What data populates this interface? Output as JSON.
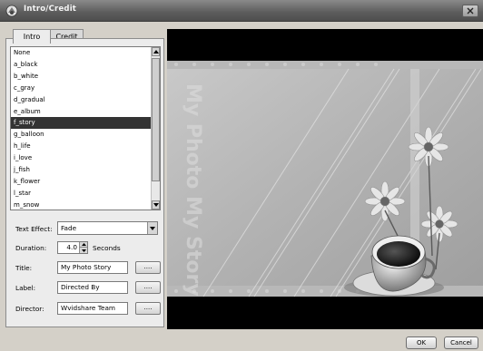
{
  "window": {
    "title": "Intro/Credit"
  },
  "tabs": [
    {
      "label": "Intro"
    },
    {
      "label": "Credit"
    }
  ],
  "templates": [
    "None",
    "a_black",
    "b_white",
    "c_gray",
    "d_gradual",
    "e_album",
    "f_story",
    "g_balloon",
    "h_life",
    "i_love",
    "j_fish",
    "k_flower",
    "l_star",
    "m_snow"
  ],
  "selected_template": "f_story",
  "fields": {
    "text_effect": {
      "label": "Text Effect:",
      "value": "Fade"
    },
    "duration": {
      "label": "Duration:",
      "value": "4.0",
      "unit": "Seconds"
    },
    "title": {
      "label": "Title:",
      "value": "My Photo Story"
    },
    "label": {
      "label": "Label:",
      "value": "Directed By"
    },
    "director": {
      "label": "Director:",
      "value": "Wvidshare Team"
    },
    "browse_label": "...."
  },
  "preview": {
    "watermark": "My Photo   My Story"
  },
  "buttons": {
    "ok": "OK",
    "cancel": "Cancel"
  }
}
